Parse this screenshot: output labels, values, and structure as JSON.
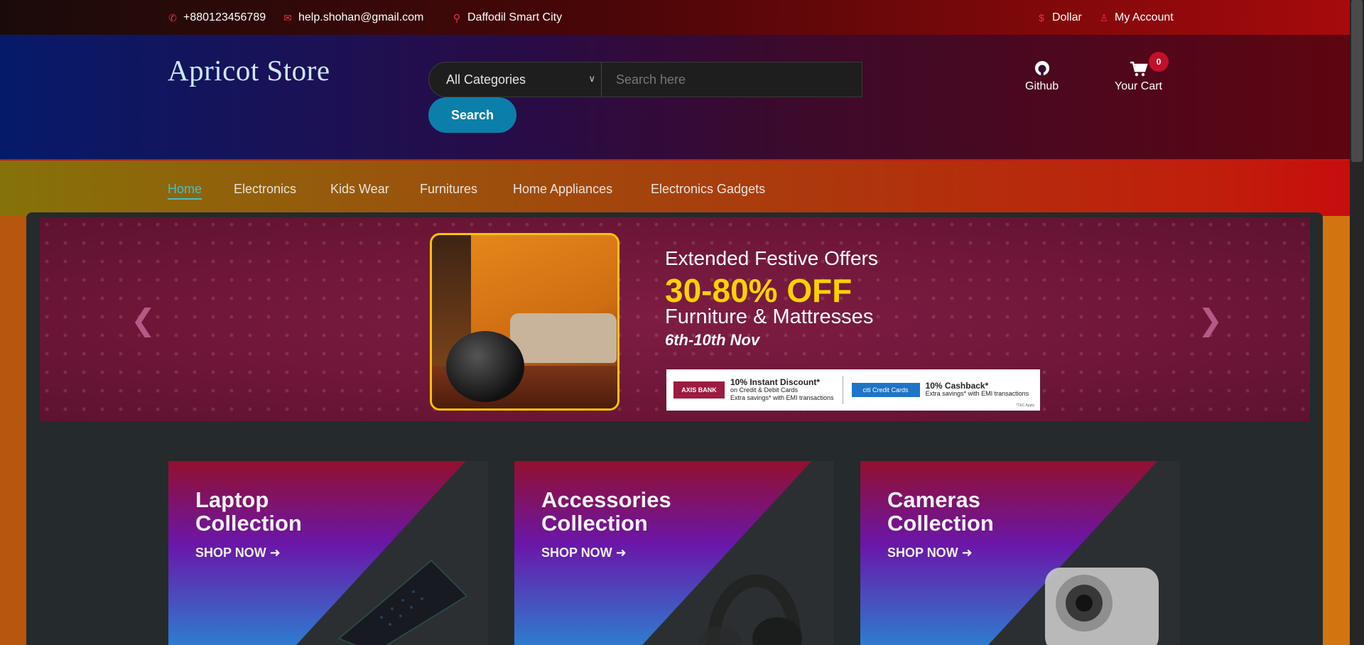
{
  "topbar": {
    "phone": "+880123456789",
    "email": "help.shohan@gmail.com",
    "location": "Daffodil Smart City",
    "currency": "Dollar",
    "account": "My Account"
  },
  "header": {
    "logo": "Apricot Store",
    "category_selected": "All Categories",
    "search_placeholder": "Search here",
    "search_button": "Search",
    "github_label": "Github",
    "cart_label": "Your Cart",
    "cart_count": "0"
  },
  "nav": {
    "items": [
      "Home",
      "Electronics",
      "Kids Wear",
      "Furnitures",
      "Home Appliances",
      "Electronics Gadgets"
    ],
    "active": "Home"
  },
  "carousel": {
    "line1": "Extended Festive Offers",
    "line2": "30-80% OFF",
    "line3": "Furniture & Mattresses",
    "line4": "6th-10th Nov",
    "bank1_logo": "AXIS BANK",
    "bank1_title": "10% Instant Discount*",
    "bank1_sub1": "on Credit & Debit Cards",
    "bank1_sub2": "Extra savings* with EMI transactions",
    "bank2_logo": "citi Credit Cards",
    "bank2_title": "10% Cashback*",
    "bank2_sub": "Extra savings* with EMI transactions",
    "tc": "*T&C Apply"
  },
  "collections": [
    {
      "title1": "Laptop",
      "title2": "Collection",
      "cta": "SHOP NOW"
    },
    {
      "title1": "Accessories",
      "title2": "Collection",
      "cta": "SHOP NOW"
    },
    {
      "title1": "Cameras",
      "title2": "Collection",
      "cta": "SHOP NOW"
    }
  ],
  "colors": {
    "accent": "#0b7fa9",
    "active_link": "#3ec1d0",
    "icon_red": "#e8334a",
    "offer_yellow": "#ffd200"
  }
}
